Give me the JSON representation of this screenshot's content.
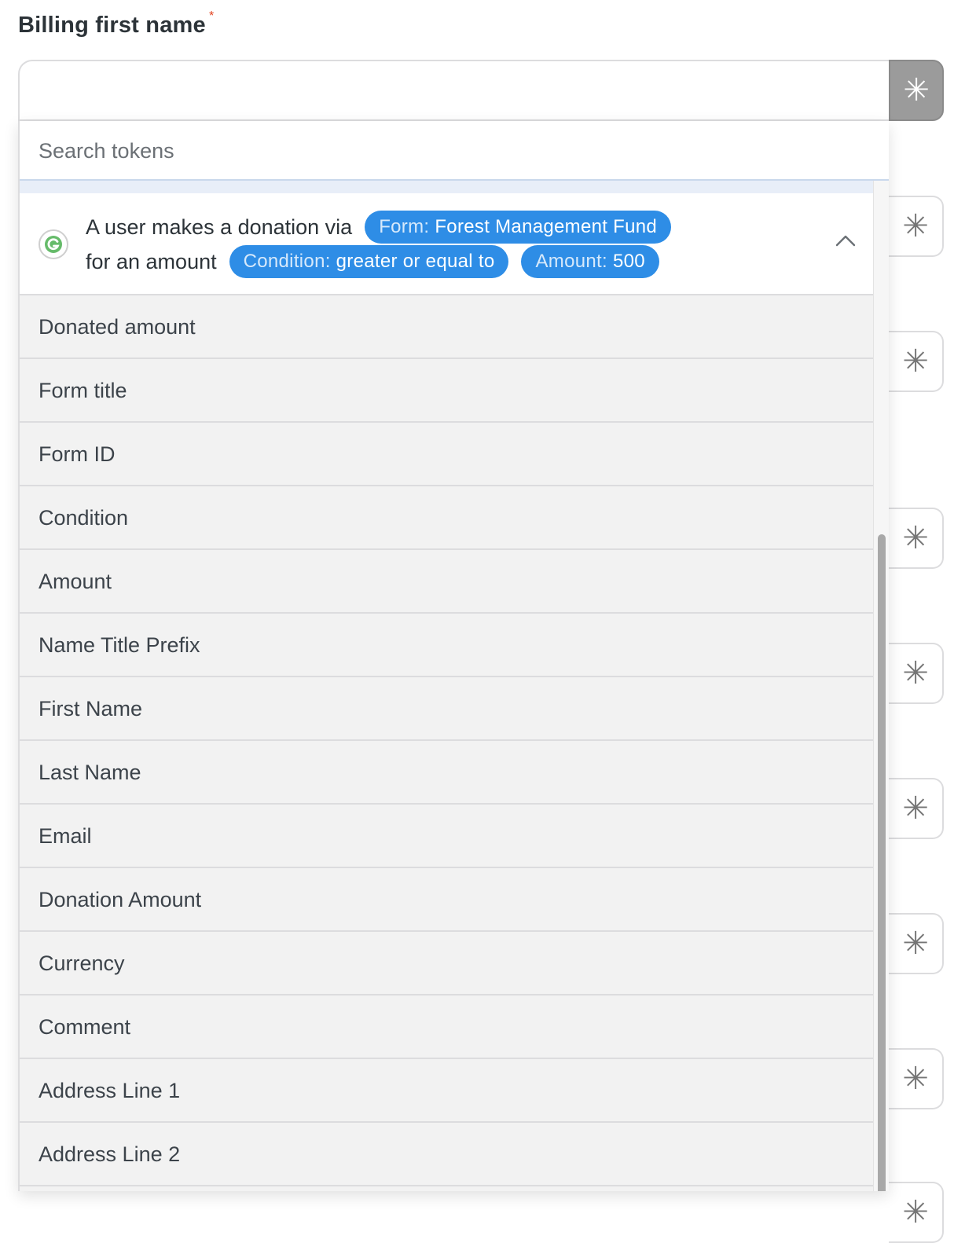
{
  "field": {
    "label": "Billing first name",
    "required_marker": "*",
    "value": ""
  },
  "token_button_glyph": "✳",
  "search": {
    "placeholder": "Search tokens",
    "value": ""
  },
  "trigger": {
    "icon": "integration-logo-icon",
    "line1_text": "A user makes a donation via",
    "pill_form_key": "Form:",
    "pill_form_value": "Forest Management Fund",
    "line2_text": "for an amount",
    "pill_condition_key": "Condition:",
    "pill_condition_value": "greater or equal to",
    "pill_amount_key": "Amount:",
    "pill_amount_value": "500",
    "expanded": true
  },
  "tokens": [
    "Donated amount",
    "Form title",
    "Form ID",
    "Condition",
    "Amount",
    "Name Title Prefix",
    "First Name",
    "Last Name",
    "Email",
    "Donation Amount",
    "Currency",
    "Comment",
    "Address Line 1",
    "Address Line 2"
  ],
  "colors": {
    "pill_bg": "#2e8de6",
    "required": "#e2401c",
    "active_token_button": "#9b9b9b"
  }
}
